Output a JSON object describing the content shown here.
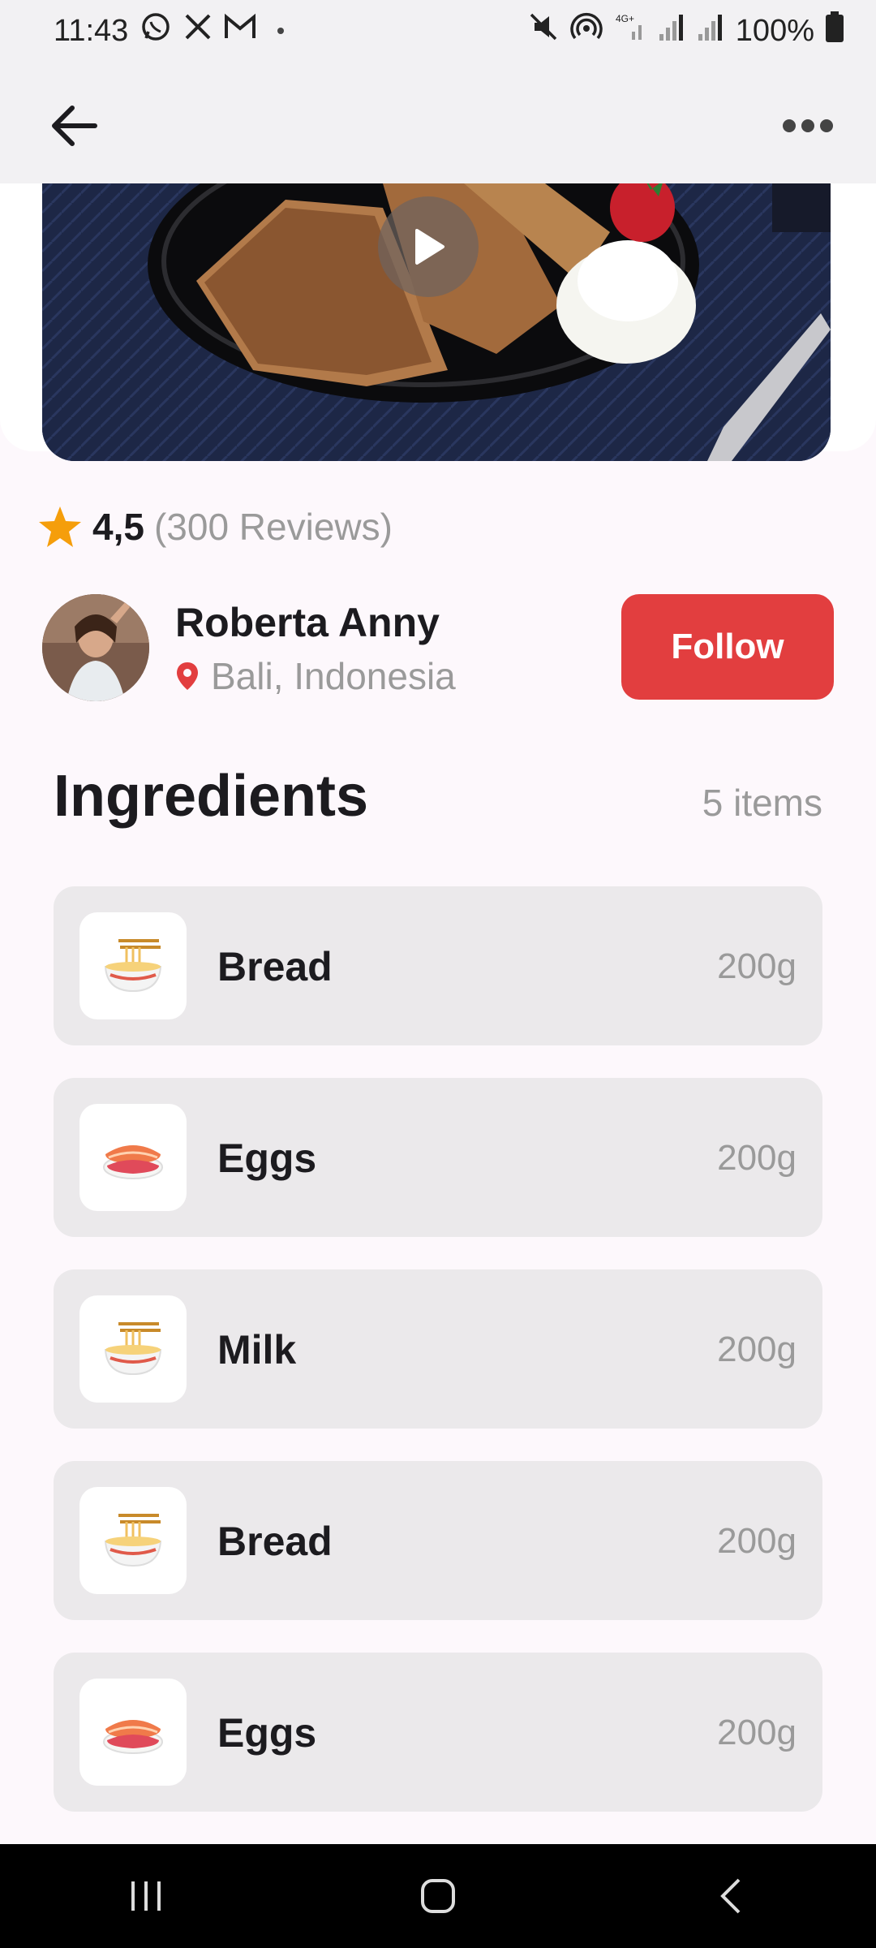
{
  "status_bar": {
    "time": "11:43",
    "battery": "100%",
    "left_icons": [
      "whatsapp-icon",
      "x-icon",
      "gmail-icon"
    ],
    "right_icons": [
      "mute-icon",
      "hotspot-icon",
      "signal-4g-icon",
      "signal-icon",
      "signal-icon",
      "battery-icon"
    ]
  },
  "app_bar": {
    "back_icon": "arrow-left-icon",
    "more_icon": "more-horizontal-icon"
  },
  "recipe": {
    "rating": "4,5",
    "reviews": "(300 Reviews)",
    "star_color": "#f59e0b"
  },
  "author": {
    "name": "Roberta Anny",
    "location": "Bali, Indonesia",
    "follow_label": "Follow",
    "accent_color": "#e23e3f"
  },
  "ingredients": {
    "title": "Ingredients",
    "count": "5 items",
    "items": [
      {
        "name": "Bread",
        "qty": "200g",
        "icon": "noodle-bowl-icon"
      },
      {
        "name": "Eggs",
        "qty": "200g",
        "icon": "sushi-icon"
      },
      {
        "name": "Milk",
        "qty": "200g",
        "icon": "noodle-bowl-icon"
      },
      {
        "name": "Bread",
        "qty": "200g",
        "icon": "noodle-bowl-icon"
      },
      {
        "name": "Eggs",
        "qty": "200g",
        "icon": "sushi-icon"
      }
    ]
  }
}
